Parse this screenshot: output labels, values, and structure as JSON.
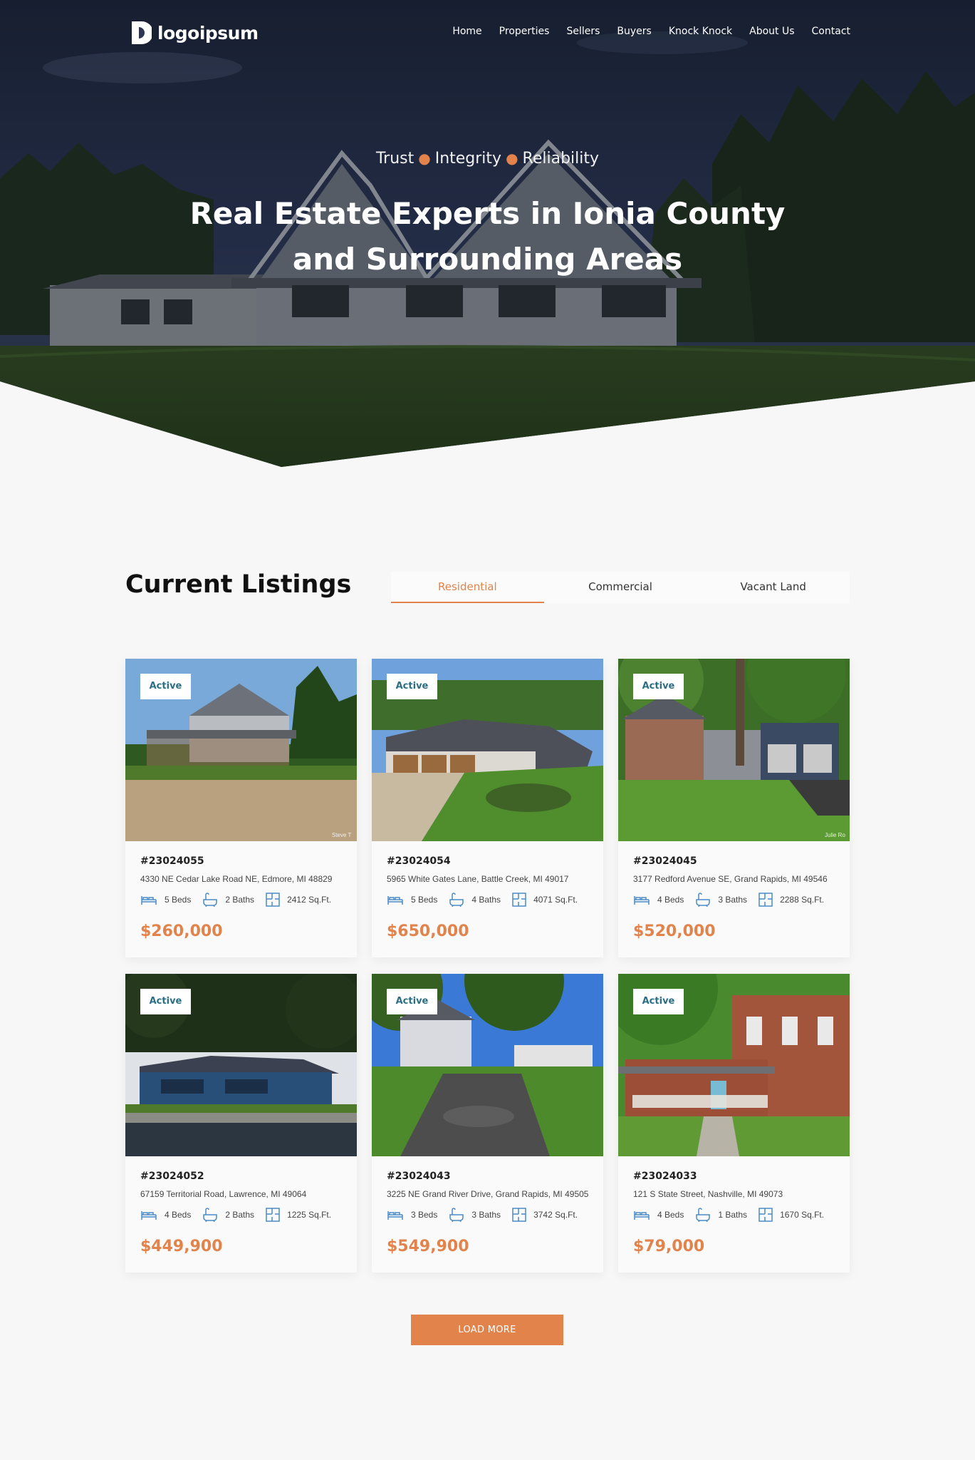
{
  "brand": {
    "logo_text": "logoipsum",
    "accent": "#e1834a",
    "badge_color": "#2b6f87",
    "icon_color": "#4b8ac6"
  },
  "nav": {
    "items": [
      "Home",
      "Properties",
      "Sellers",
      "Buyers",
      "Knock Knock",
      "About Us",
      "Contact"
    ]
  },
  "hero": {
    "tagline": [
      "Trust",
      "Integrity",
      "Reliability"
    ],
    "title_line1": "Real Estate Experts in Ionia County",
    "title_line2": "and Surrounding Areas"
  },
  "listings": {
    "title": "Current Listings",
    "tabs": [
      "Residential",
      "Commercial",
      "Vacant Land"
    ],
    "active_tab": "Residential",
    "cards": [
      {
        "status": "Active",
        "mls": "#23024055",
        "address": "4330 NE Cedar Lake Road NE, Edmore, MI 48829",
        "beds": "5 Beds",
        "baths": "2 Baths",
        "sqft": "2412 Sq.Ft.",
        "price": "$260,000",
        "photo_credit": "Steve T"
      },
      {
        "status": "Active",
        "mls": "#23024054",
        "address": "5965 White Gates Lane, Battle Creek, MI 49017",
        "beds": "5 Beds",
        "baths": "4 Baths",
        "sqft": "4071 Sq.Ft.",
        "price": "$650,000"
      },
      {
        "status": "Active",
        "mls": "#23024045",
        "address": "3177 Redford Avenue SE, Grand Rapids, MI 49546",
        "beds": "4 Beds",
        "baths": "3 Baths",
        "sqft": "2288 Sq.Ft.",
        "price": "$520,000",
        "photo_credit": "Julie Ro"
      },
      {
        "status": "Active",
        "mls": "#23024052",
        "address": "67159 Territorial Road, Lawrence, MI 49064",
        "beds": "4 Beds",
        "baths": "2 Baths",
        "sqft": "1225 Sq.Ft.",
        "price": "$449,900"
      },
      {
        "status": "Active",
        "mls": "#23024043",
        "address": "3225 NE Grand River Drive, Grand Rapids, MI 49505",
        "beds": "3 Beds",
        "baths": "3 Baths",
        "sqft": "3742 Sq.Ft.",
        "price": "$549,900"
      },
      {
        "status": "Active",
        "mls": "#23024033",
        "address": "121 S State Street, Nashville, MI 49073",
        "beds": "4 Beds",
        "baths": "1 Baths",
        "sqft": "1670 Sq.Ft.",
        "price": "$79,000"
      }
    ],
    "load_more": "LOAD MORE"
  }
}
